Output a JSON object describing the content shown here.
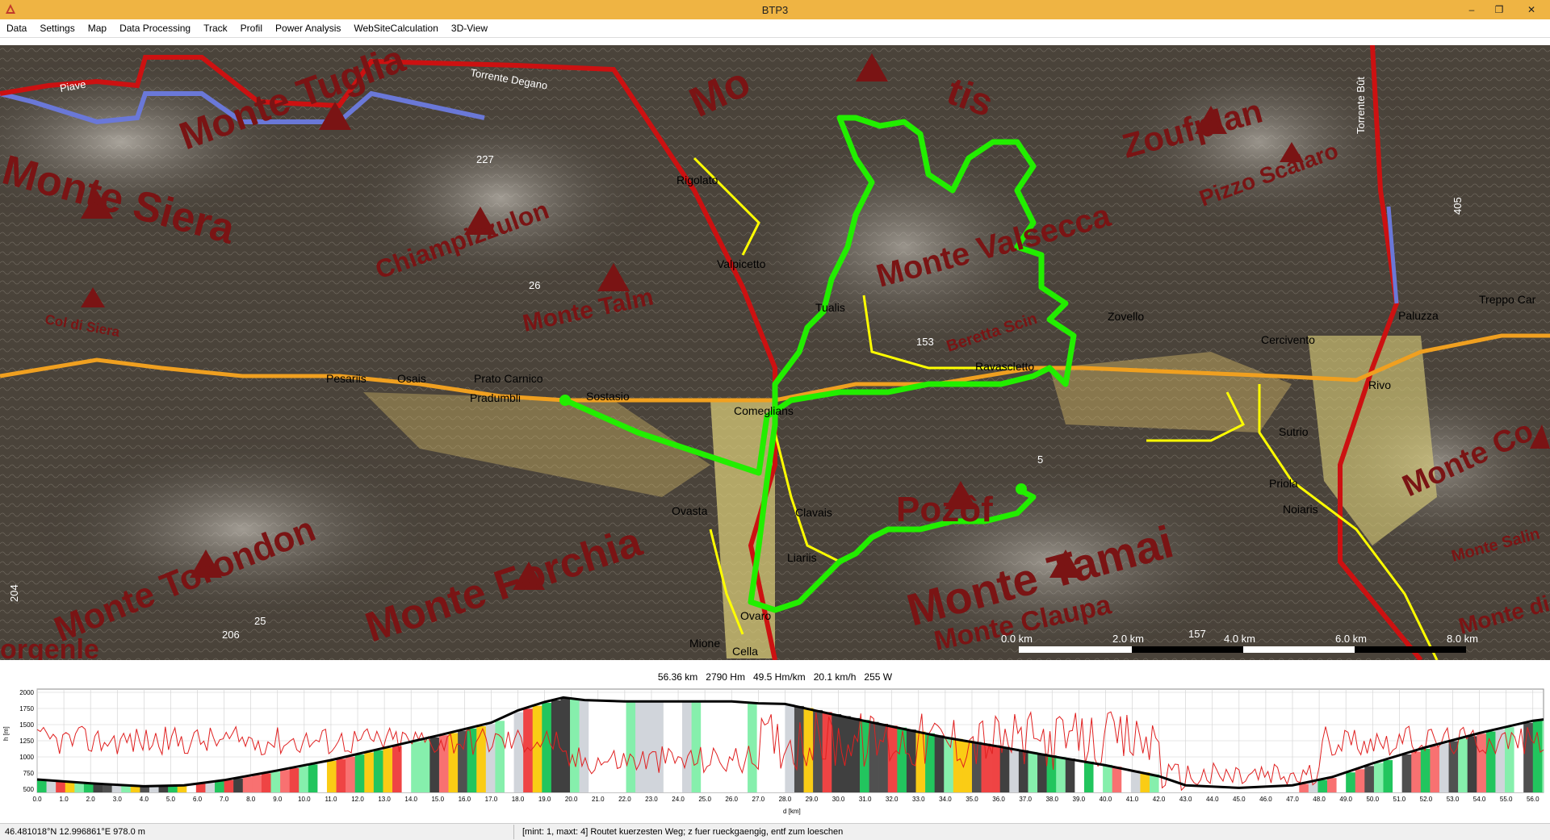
{
  "window": {
    "title": "BTP3",
    "minimize": "–",
    "maximize": "❐",
    "close": "✕"
  },
  "menu": [
    "Data",
    "Settings",
    "Map",
    "Data Processing",
    "Track",
    "Profil",
    "Power Analysis",
    "WebSiteCalculation",
    "3D-View"
  ],
  "map": {
    "peaks": [
      "Monte Tuglia",
      "Monte Siera",
      "Chiampizzulon",
      "Monte Talm",
      "Col di Siera",
      "Monte Torondon",
      "Monte Forchia",
      "Monte Tamai",
      "Pozôf",
      "Zoufplan",
      "Pizzo Scalaro",
      "Monte Valsecca",
      "Monte Claupa",
      "Monte Salin",
      "Monte Co",
      "Monte di",
      "Beretta Scin",
      "Mo",
      "tis",
      "orgenle"
    ],
    "towns": [
      "Rigolato",
      "Valpicetto",
      "Pesariis",
      "Osais",
      "Prato Carnico",
      "Pradumbli",
      "Sostasio",
      "Comeglians",
      "Ravascletto",
      "Zovello",
      "Cercivento",
      "Paluzza",
      "Treppo Car",
      "Rivo",
      "Sutrio",
      "Priola",
      "Noiaris",
      "Ovasta",
      "Clavais",
      "Liariis",
      "Ovaro",
      "Mione",
      "Cella",
      "Tualis"
    ],
    "rivers": [
      "Piave",
      "Torrente Degano",
      "Torrente Bût"
    ],
    "numbers": [
      "227",
      "26",
      "204",
      "206",
      "25",
      "405",
      "153",
      "157",
      "5"
    ],
    "scale": [
      "0.0 km",
      "2.0 km",
      "4.0 km",
      "6.0 km",
      "8.0 km"
    ],
    "colors": {
      "track": "#22ee00",
      "main_road": "#cc1111",
      "secondary_road": "#f0a020",
      "minor_road": "#ffff00",
      "peak_label": "#7a1414"
    }
  },
  "stats": {
    "distance": "56.36 km",
    "ascent": "2790 Hm",
    "rate": "49.5 Hm/km",
    "speed": "20.1 km/h",
    "power": "255 W"
  },
  "profile": {
    "y_label": "h [m]",
    "x_label": "d [km]",
    "y_ticks": [
      "2000",
      "1750",
      "1500",
      "1250",
      "1000",
      "750",
      "500"
    ],
    "x_ticks": [
      "0.0",
      "1.0",
      "2.0",
      "3.0",
      "4.0",
      "5.0",
      "6.0",
      "7.0",
      "8.0",
      "9.0",
      "10.0",
      "11.0",
      "12.0",
      "13.0",
      "14.0",
      "15.0",
      "16.0",
      "17.0",
      "18.0",
      "19.0",
      "20.0",
      "21.0",
      "22.0",
      "23.0",
      "24.0",
      "25.0",
      "26.0",
      "27.0",
      "28.0",
      "29.0",
      "30.0",
      "31.0",
      "32.0",
      "33.0",
      "34.0",
      "35.0",
      "36.0",
      "37.0",
      "38.0",
      "39.0",
      "40.0",
      "41.0",
      "42.0",
      "43.0",
      "44.0",
      "45.0",
      "46.0",
      "47.0",
      "48.0",
      "49.0",
      "50.0",
      "51.0",
      "52.0",
      "53.0",
      "54.0",
      "55.0",
      "56.0"
    ],
    "elevation": [
      {
        "d": 0,
        "h": 650
      },
      {
        "d": 2,
        "h": 590
      },
      {
        "d": 4,
        "h": 545
      },
      {
        "d": 5.5,
        "h": 560
      },
      {
        "d": 7,
        "h": 640
      },
      {
        "d": 9,
        "h": 790
      },
      {
        "d": 11,
        "h": 950
      },
      {
        "d": 13,
        "h": 1140
      },
      {
        "d": 15,
        "h": 1330
      },
      {
        "d": 17,
        "h": 1530
      },
      {
        "d": 18,
        "h": 1720
      },
      {
        "d": 19,
        "h": 1850
      },
      {
        "d": 19.7,
        "h": 1920
      },
      {
        "d": 20.5,
        "h": 1880
      },
      {
        "d": 22,
        "h": 1860
      },
      {
        "d": 24,
        "h": 1860
      },
      {
        "d": 26,
        "h": 1860
      },
      {
        "d": 27,
        "h": 1830
      },
      {
        "d": 28,
        "h": 1820
      },
      {
        "d": 30,
        "h": 1640
      },
      {
        "d": 32,
        "h": 1470
      },
      {
        "d": 34,
        "h": 1300
      },
      {
        "d": 36,
        "h": 1160
      },
      {
        "d": 38,
        "h": 1010
      },
      {
        "d": 40,
        "h": 870
      },
      {
        "d": 42,
        "h": 700
      },
      {
        "d": 43,
        "h": 560
      },
      {
        "d": 45,
        "h": 520
      },
      {
        "d": 47,
        "h": 560
      },
      {
        "d": 48.5,
        "h": 690
      },
      {
        "d": 50,
        "h": 900
      },
      {
        "d": 52,
        "h": 1150
      },
      {
        "d": 54,
        "h": 1370
      },
      {
        "d": 56,
        "h": 1560
      },
      {
        "d": 56.4,
        "h": 1580
      }
    ]
  },
  "status": {
    "coords": "46.481018°N  12.996861°E  978.0 m",
    "message": "[mint: 1, maxt: 4] Routet kuerzesten Weg; z fuer rueckgaengig, entf zum loeschen"
  }
}
